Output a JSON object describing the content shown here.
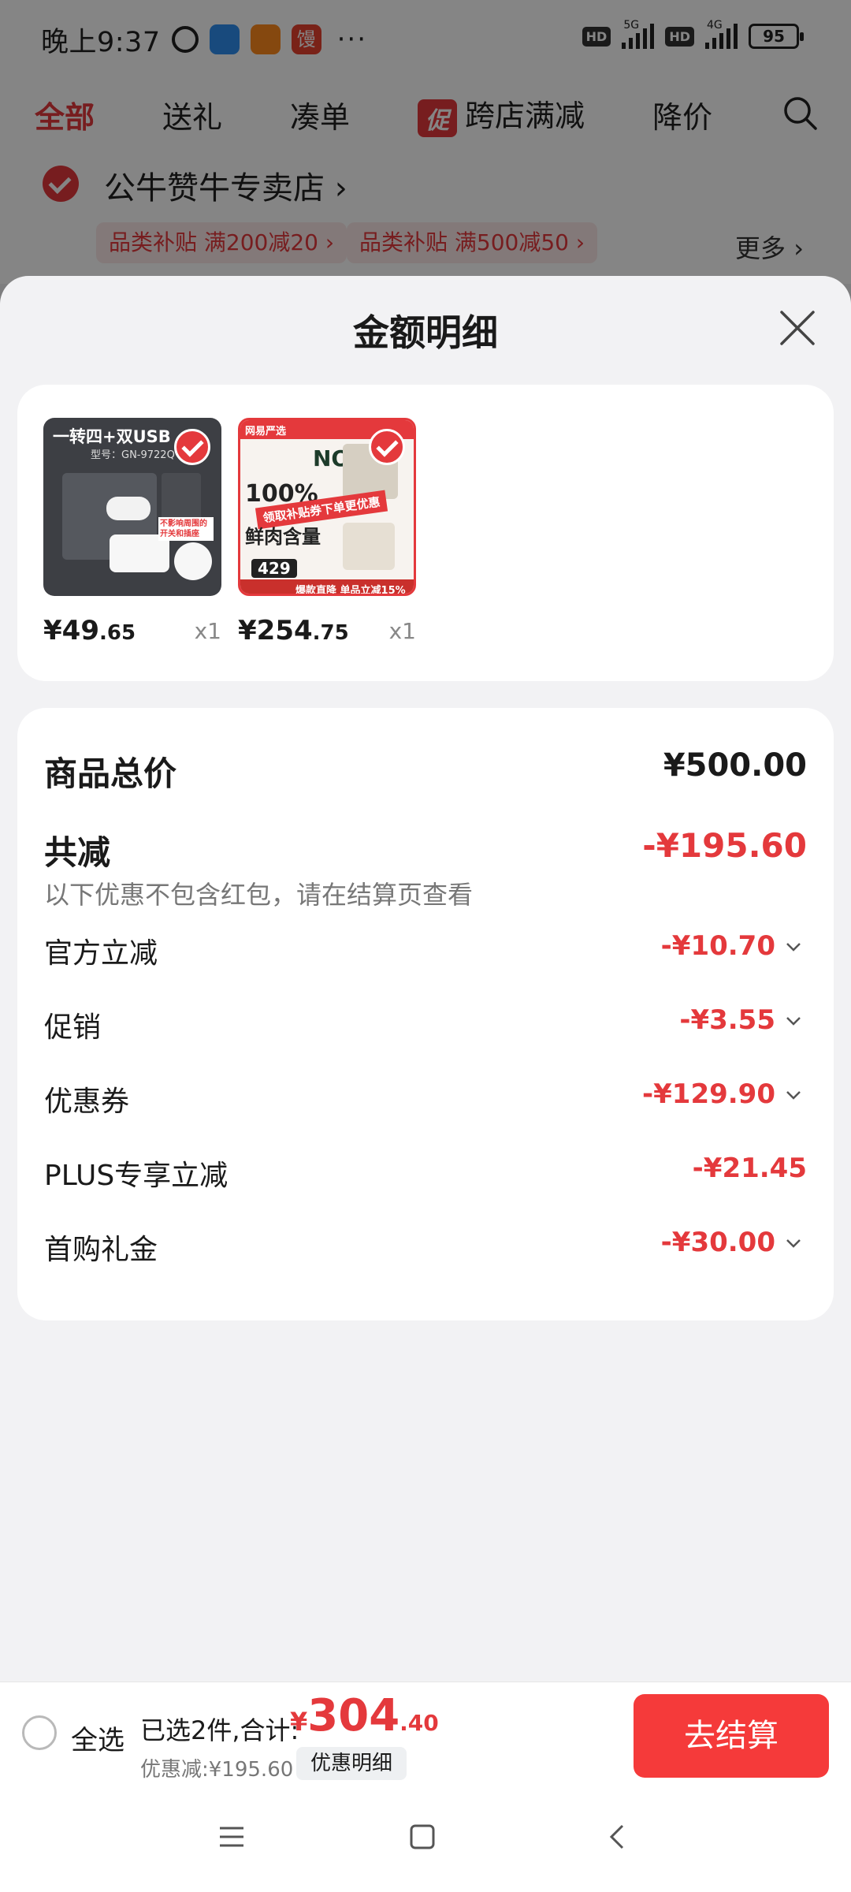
{
  "status_bar": {
    "time": "晚上9:37",
    "app_badge": "馒",
    "more": "···",
    "hd1": "HD",
    "net1": "5G",
    "hd2": "HD",
    "net2": "4G",
    "battery": "95"
  },
  "nav": {
    "tabs": [
      "全部",
      "送礼",
      "凑单",
      "跨店满减",
      "降价"
    ],
    "promo_badge": "促"
  },
  "store": {
    "name": "公牛赞牛专卖店 ›",
    "tags": [
      "品类补贴  满200减20 ›",
      "品类补贴  满500减50 ›"
    ],
    "more": "更多 ›"
  },
  "sheet": {
    "title": "金额明细",
    "products": [
      {
        "price_int": "¥49",
        "price_dec": ".65",
        "qty": "x1",
        "img_title": "一转四+双USB",
        "img_model": "型号：GN-9722Q",
        "img_note": "不影响周围的开关和插座"
      },
      {
        "price_int": "¥254",
        "price_dec": ".75",
        "qty": "x1",
        "img_brand": "网易严选",
        "img_no1": "NO.1",
        "img_pct": "100%",
        "img_banner": "领取补贴券下单更优惠",
        "img_sub": "鲜肉含量",
        "img_price": "429",
        "img_footer": "爆款直降 单品立减15%"
      }
    ],
    "total": {
      "label": "商品总价",
      "value": "¥500.00"
    },
    "reduce": {
      "label": "共减",
      "value": "-¥195.60",
      "note": "以下优惠不包含红包，请在结算页查看"
    },
    "items": [
      {
        "label": "官方立减",
        "value": "-¥10.70",
        "chevron": true
      },
      {
        "label": "促销",
        "value": "-¥3.55",
        "chevron": true
      },
      {
        "label": "优惠券",
        "value": "-¥129.90",
        "chevron": true
      },
      {
        "label": "PLUS专享立减",
        "value": "-¥21.45",
        "chevron": false
      },
      {
        "label": "首购礼金",
        "value": "-¥30.00",
        "chevron": true
      }
    ]
  },
  "bottom_bar": {
    "select_all": "全选",
    "selected": "已选2件,合计:",
    "total_symbol": "¥",
    "total_int": "304",
    "total_dec": ".40",
    "discount": "优惠减:¥195.60",
    "detail_button": "优惠明细",
    "checkout": "去结算"
  },
  "colors": {
    "accent": "#e4393c",
    "checkout": "#f53a3a",
    "background": "#f2f2f4"
  }
}
